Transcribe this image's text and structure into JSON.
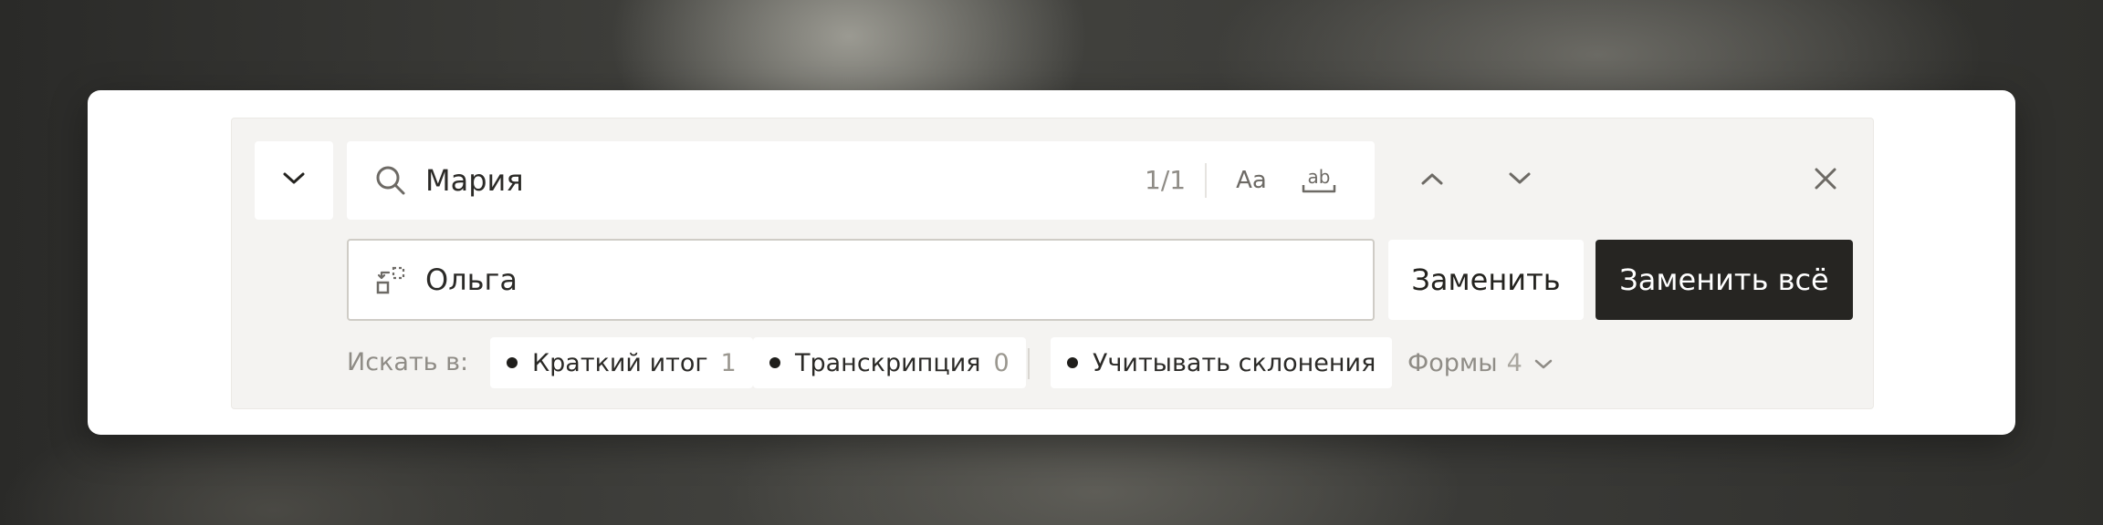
{
  "find": {
    "value": "Мария",
    "match_count": "1/1",
    "case_label": "Aa",
    "word_label": "ab"
  },
  "replace": {
    "value": "Ольга",
    "replace_label": "Заменить",
    "replace_all_label": "Заменить всё"
  },
  "filters": {
    "label": "Искать в:",
    "scopes": [
      {
        "label": "Краткий итог",
        "count": "1"
      },
      {
        "label": "Транскрипция",
        "count": "0"
      }
    ],
    "declensions_label": "Учитывать склонения",
    "forms_label": "Формы",
    "forms_count": "4"
  },
  "colors": {
    "accent_dark": "#262522",
    "panel_bg": "#f4f3f1",
    "muted_text": "#8f8c86"
  },
  "icons": {
    "collapse": "chevron-down-icon",
    "search": "search-icon",
    "replace": "replace-icon",
    "prev": "chevron-up-icon",
    "next": "chevron-down-icon",
    "close": "close-icon",
    "forms_dropdown": "chevron-down-icon"
  }
}
